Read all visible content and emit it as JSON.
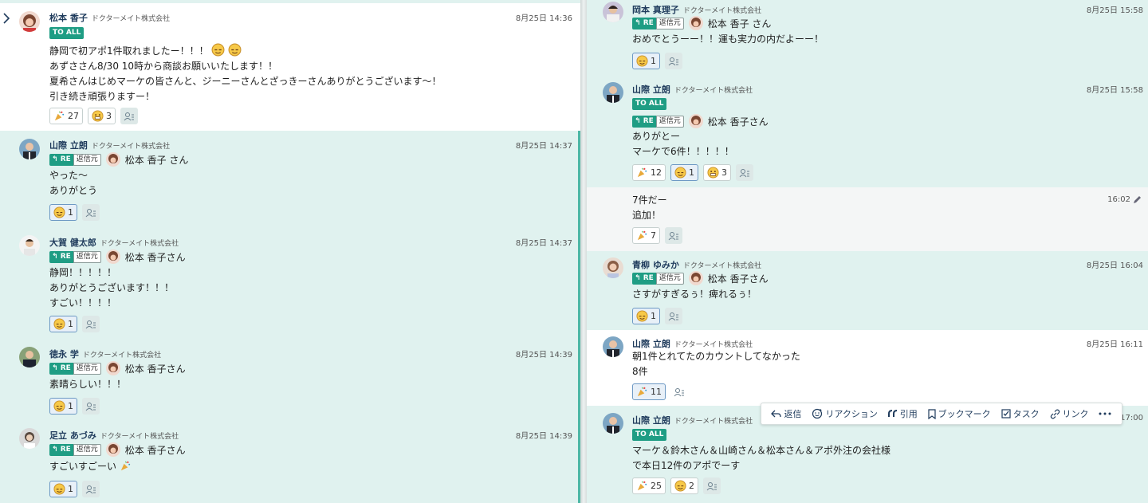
{
  "left_messages": [
    {
      "name": "松本 香子",
      "company": "ドクターメイト株式会社",
      "time": "8月25日 14:36",
      "to_all": "TO ALL",
      "lines": [
        "静岡で初アポ1件取れましたー！！！",
        "あずささん8/30 10時から商談お願いいたします！！",
        "夏希さんはじめマーケの皆さんと、ジーニーさんとざっきーさんありがとうございます〜！",
        "引き続き頑張りますー！"
      ],
      "reactions": [
        {
          "emoji": "party-popper-icon",
          "count": "27"
        },
        {
          "emoji": "grin-face-icon",
          "count": "3"
        }
      ]
    },
    {
      "name": "山際 立朗",
      "company": "ドクターメイト株式会社",
      "time": "8月25日 14:37",
      "re": {
        "tag": "RE",
        "source": "返信元",
        "to": "松本 香子 さん"
      },
      "lines": [
        "やった〜",
        "ありがとう"
      ],
      "reactions": [
        {
          "emoji": "bow-face-icon",
          "count": "1"
        }
      ]
    },
    {
      "name": "大賀 健太郎",
      "company": "ドクターメイト株式会社",
      "time": "8月25日 14:37",
      "re": {
        "tag": "RE",
        "source": "返信元",
        "to": "松本 香子さん"
      },
      "lines": [
        "静岡！！！！！",
        "ありがとうございます！！！",
        "すごい！！！！"
      ],
      "reactions": [
        {
          "emoji": "bow-face-icon",
          "count": "1"
        }
      ]
    },
    {
      "name": "徳永 学",
      "company": "ドクターメイト株式会社",
      "time": "8月25日 14:39",
      "re": {
        "tag": "RE",
        "source": "返信元",
        "to": "松本 香子さん"
      },
      "lines": [
        "素晴らしい！！！"
      ],
      "reactions": [
        {
          "emoji": "bow-face-icon",
          "count": "1"
        }
      ]
    },
    {
      "name": "足立 あづみ",
      "company": "ドクターメイト株式会社",
      "time": "8月25日 14:39",
      "re": {
        "tag": "RE",
        "source": "返信元",
        "to": "松本 香子さん"
      },
      "lines": [
        "すごいすごーい"
      ],
      "reactions": [
        {
          "emoji": "bow-face-icon",
          "count": "1"
        }
      ]
    }
  ],
  "right_messages": [
    {
      "name": "岡本 真理子",
      "company": "ドクターメイト株式会社",
      "time": "8月25日 15:58",
      "re": {
        "tag": "RE",
        "source": "返信元",
        "to": "松本 香子 さん"
      },
      "lines": [
        "おめでとうーー！！運も実力の内だよーー！"
      ],
      "reactions": [
        {
          "emoji": "bow-face-icon",
          "count": "1"
        }
      ]
    },
    {
      "name": "山際 立朗",
      "company": "ドクターメイト株式会社",
      "time": "8月25日 15:58",
      "to_all": "TO ALL",
      "re": {
        "tag": "RE",
        "source": "返信元",
        "to": "松本 香子さん"
      },
      "lines": [
        "ありがとー",
        "マーケで6件！！！！！"
      ],
      "reactions": [
        {
          "emoji": "party-popper-icon",
          "count": "12"
        },
        {
          "emoji": "bow-face-icon",
          "count": "1"
        },
        {
          "emoji": "grin-face-icon",
          "count": "3"
        }
      ]
    },
    {
      "time": "16:02",
      "lines": [
        "7件だー",
        "追加！"
      ],
      "reactions": [
        {
          "emoji": "party-popper-icon",
          "count": "7"
        }
      ]
    },
    {
      "name": "青柳 ゆみか",
      "company": "ドクターメイト株式会社",
      "time": "8月25日 16:04",
      "re": {
        "tag": "RE",
        "source": "返信元",
        "to": "松本 香子さん"
      },
      "lines": [
        "さすがすぎるぅ！痺れるぅ！"
      ],
      "reactions": [
        {
          "emoji": "bow-face-icon",
          "count": "1"
        }
      ]
    },
    {
      "name": "山際 立朗",
      "company": "ドクターメイト株式会社",
      "time": "8月25日 16:11",
      "lines": [
        "朝1件とれてたのカウントしてなかった",
        "8件"
      ],
      "reactions": [
        {
          "emoji": "party-popper-icon",
          "count": "11"
        }
      ]
    },
    {
      "name": "山際 立朗",
      "company": "ドクターメイト株式会社",
      "time": "17:00",
      "to_all": "TO ALL",
      "lines": [
        "マーケ＆鈴木さん＆山崎さん＆松本さん＆アポ外注の会社様",
        "で本日12件のアポでーす"
      ],
      "reactions": [
        {
          "emoji": "party-popper-icon",
          "count": "25"
        },
        {
          "emoji": "bow-face-icon",
          "count": "2"
        }
      ]
    }
  ],
  "toolbar": {
    "reply": "返信",
    "reaction": "リアクション",
    "quote": "引用",
    "bookmark": "ブックマーク",
    "task": "タスク",
    "link": "リンク"
  },
  "colors": {
    "accent": "#1f9d84",
    "thread_bg": "#e0f2ef",
    "name": "#1f3b5c"
  }
}
